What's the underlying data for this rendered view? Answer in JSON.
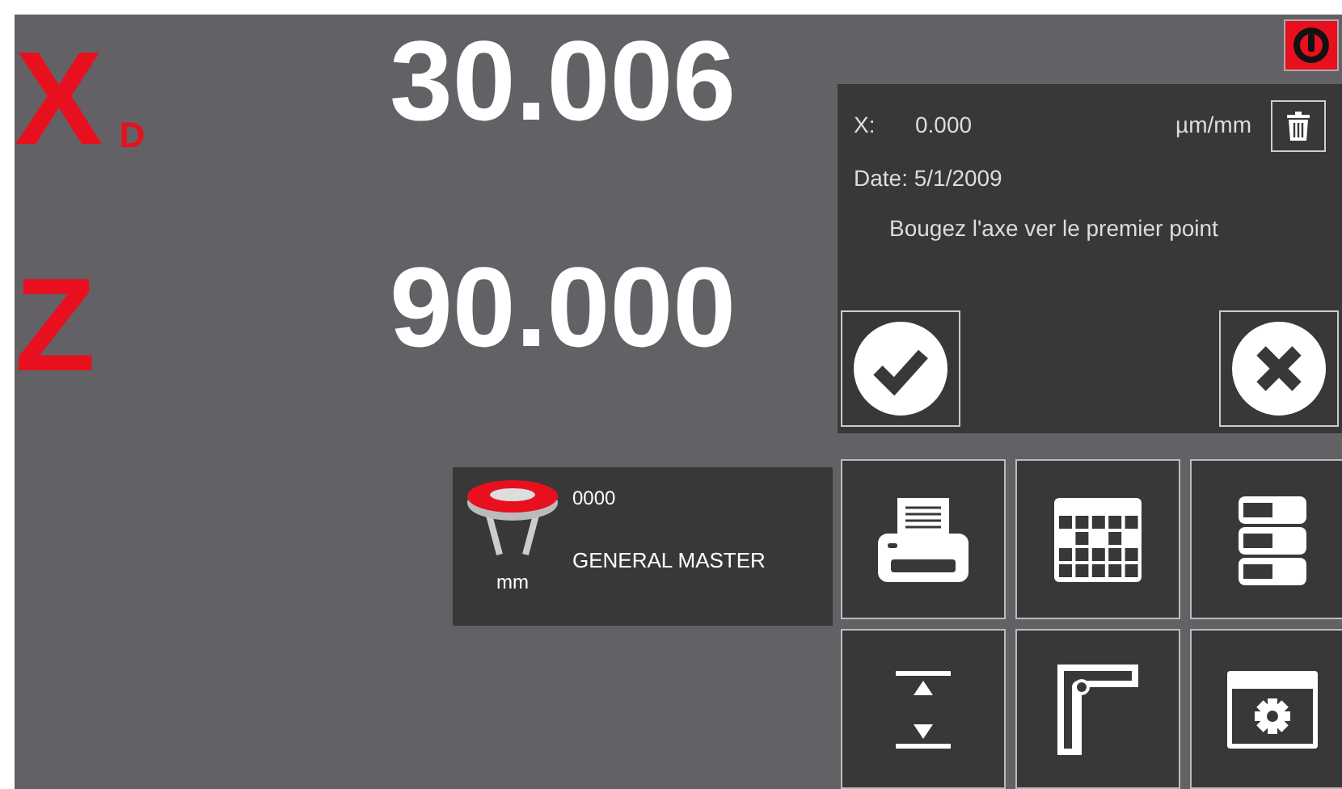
{
  "axes": [
    {
      "letter": "X",
      "suffix": "D",
      "value": "30.006"
    },
    {
      "letter": "Z",
      "value": "90.000"
    }
  ],
  "dialog": {
    "axis_label": "X:",
    "value": "0.000",
    "unit": "µm/mm",
    "date": "Date: 5/1/2009",
    "message": "Bougez l'axe ver le premier point"
  },
  "tool": {
    "code": "0000",
    "name": "GENERAL MASTER",
    "unit": "mm"
  },
  "function_buttons": [
    {
      "kind": "printer"
    },
    {
      "kind": "table"
    },
    {
      "kind": "stack"
    },
    {
      "kind": "gap"
    },
    {
      "kind": "ruler"
    },
    {
      "kind": "settings"
    }
  ]
}
